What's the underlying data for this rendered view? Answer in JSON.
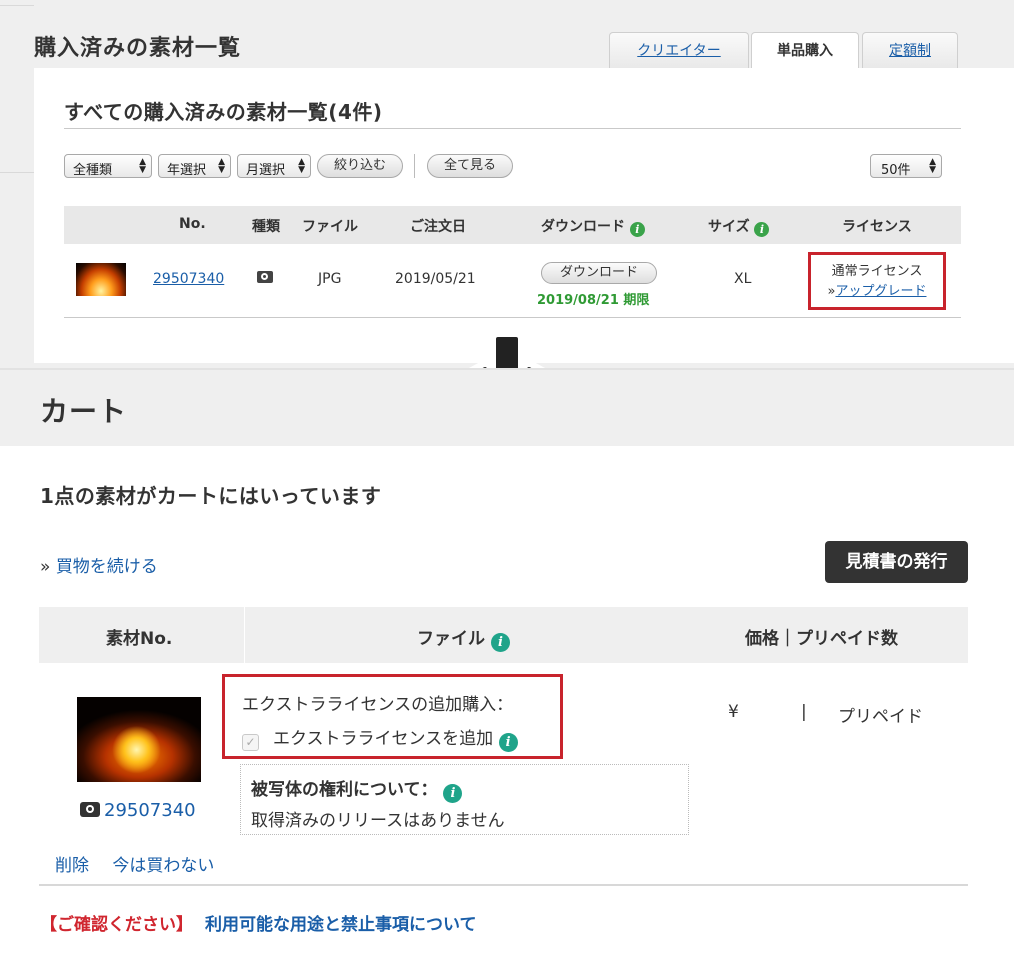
{
  "purchased": {
    "title": "購入済みの素材一覧",
    "tabs": [
      {
        "label": "クリエイター",
        "active": false
      },
      {
        "label": "単品購入",
        "active": true
      },
      {
        "label": "定額制",
        "active": false
      }
    ],
    "subtitle": "すべての購入済みの素材一覧(4件)",
    "filters": {
      "type": "全種類",
      "year": "年選択",
      "month": "月選択",
      "narrow_button": "絞り込む",
      "all_button": "全て見る",
      "per_page": "50件"
    },
    "columns": [
      "No.",
      "種類",
      "ファイル",
      "ご注文日",
      "ダウンロード",
      "サイズ",
      "ライセンス"
    ],
    "row": {
      "thumbnail_icon": "campfire-thumbnail",
      "number": "29507340",
      "type_icon": "camera-icon",
      "file": "JPG",
      "order_date": "2019/05/21",
      "download_button": "ダウンロード",
      "download_expiry": "2019/08/21 期限",
      "size": "XL",
      "license": "通常ライセンス",
      "upgrade_prefix": "»",
      "upgrade_link": "アップグレード"
    }
  },
  "cart": {
    "title": "カート",
    "count_text": "1点の素材がカートにはいっています",
    "continue_prefix": "»",
    "continue_link": "買物を続ける",
    "quote_button": "見積書の発行",
    "columns": [
      "素材No.",
      "ファイル",
      "価格｜プリペイド数"
    ],
    "item": {
      "number": "29507340",
      "extra_license_title": "エクストラライセンスの追加購入：",
      "extra_license_checkbox": "エクストラライセンスを追加",
      "extra_license_checked": true,
      "rights_title": "被写体の権利について：",
      "rights_text": "取得済みのリリースはありません",
      "price_symbol": "¥",
      "price_separator": "|",
      "prepaid_label": "プリペイド",
      "delete_link": "削除",
      "later_link": "今は買わない"
    },
    "notice_label": "【ご確認ください】",
    "notice_link": "利用可能な用途と禁止事項について"
  },
  "colors": {
    "link": "#1a5ea8",
    "highlight_border": "#c8232c",
    "expiry_green": "#2f9a34",
    "info_icon": "#1fa48a",
    "notice_red": "#d0262f"
  }
}
